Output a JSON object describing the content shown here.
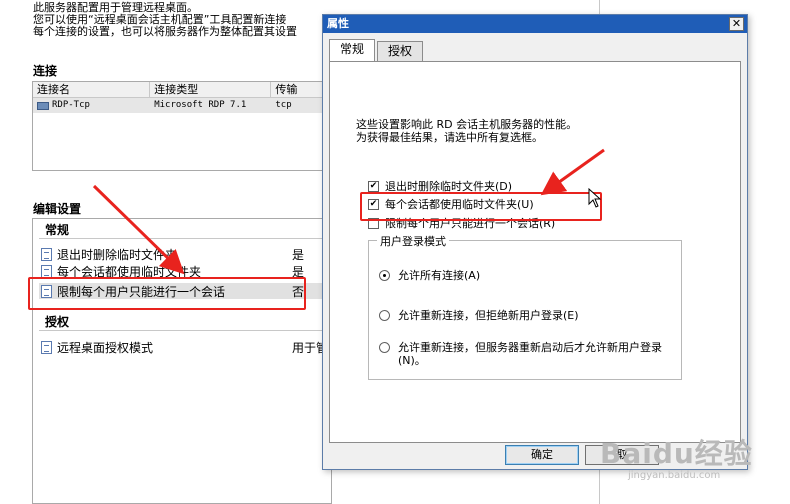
{
  "intro": {
    "line1": "此服务器配置用于管理远程桌面。",
    "line2": "您可以使用“远程桌面会话主机配置”工具配置新连接",
    "line3": "每个连接的设置，也可以将服务器作为整体配置其设置"
  },
  "connections": {
    "title": "连接",
    "columns": [
      "连接名",
      "连接类型",
      "传输"
    ],
    "rows": [
      {
        "name": "RDP-Tcp",
        "type": "Microsoft RDP 7.1",
        "transport": "tcp"
      }
    ]
  },
  "edit": {
    "title": "编辑设置",
    "general_group": "常规",
    "general_items": [
      {
        "label": "退出时删除临时文件夹",
        "value": "是"
      },
      {
        "label": "每个会话都使用临时文件夹",
        "value": "是"
      },
      {
        "label": "限制每个用户只能进行一个会话",
        "value": "否"
      }
    ],
    "license_group": "授权",
    "license_items": [
      {
        "label": "远程桌面授权模式",
        "value": "用于管"
      }
    ]
  },
  "dialog": {
    "title": "属性",
    "close": "✕",
    "tabs": [
      "常规",
      "授权"
    ],
    "desc_line1": "这些设置影响此 RD 会话主机服务器的性能。",
    "desc_line2": "为获得最佳结果，请选中所有复选框。",
    "checkboxes": [
      {
        "label": "退出时删除临时文件夹(D)",
        "checked": true
      },
      {
        "label": "每个会话都使用临时文件夹(U)",
        "checked": true
      },
      {
        "label": "限制每个用户只能进行一个会话(R)",
        "checked": false
      }
    ],
    "login_mode": {
      "legend": "用户登录模式",
      "options": [
        {
          "label": "允许所有连接(A)",
          "selected": true
        },
        {
          "label": "允许重新连接，但拒绝新用户登录(E)",
          "selected": false
        },
        {
          "label": "允许重新连接，但服务器重新启动后才允许新用户登录(N)。",
          "selected": false
        }
      ]
    },
    "ok": "确定",
    "cancel": "取"
  },
  "watermark": {
    "text": "Baidu经验",
    "sub": "jingyan.baidu.com"
  },
  "colors": {
    "highlight": "#e8231e",
    "titlebar": "#1f5db7"
  }
}
